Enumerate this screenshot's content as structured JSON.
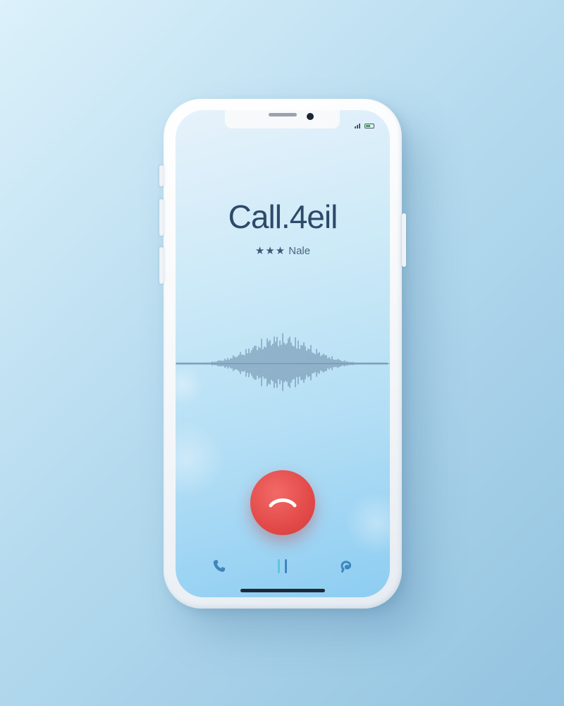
{
  "call": {
    "title": "Call.4eil",
    "rating_stars": "★★★",
    "subtitle": "Nale"
  },
  "status_bar": {
    "signal_icon": "signal-icon",
    "battery_icon": "battery-icon"
  },
  "controls": {
    "end_call_icon": "phone-hangup-icon",
    "bottom": [
      "phone-icon",
      "pause-icon",
      "swirl-icon"
    ]
  },
  "colors": {
    "end_call": "#e24a49",
    "title": "#2e4a6a",
    "icons": "#4a8fc4",
    "screen_bottom": "#8dcdf2"
  }
}
